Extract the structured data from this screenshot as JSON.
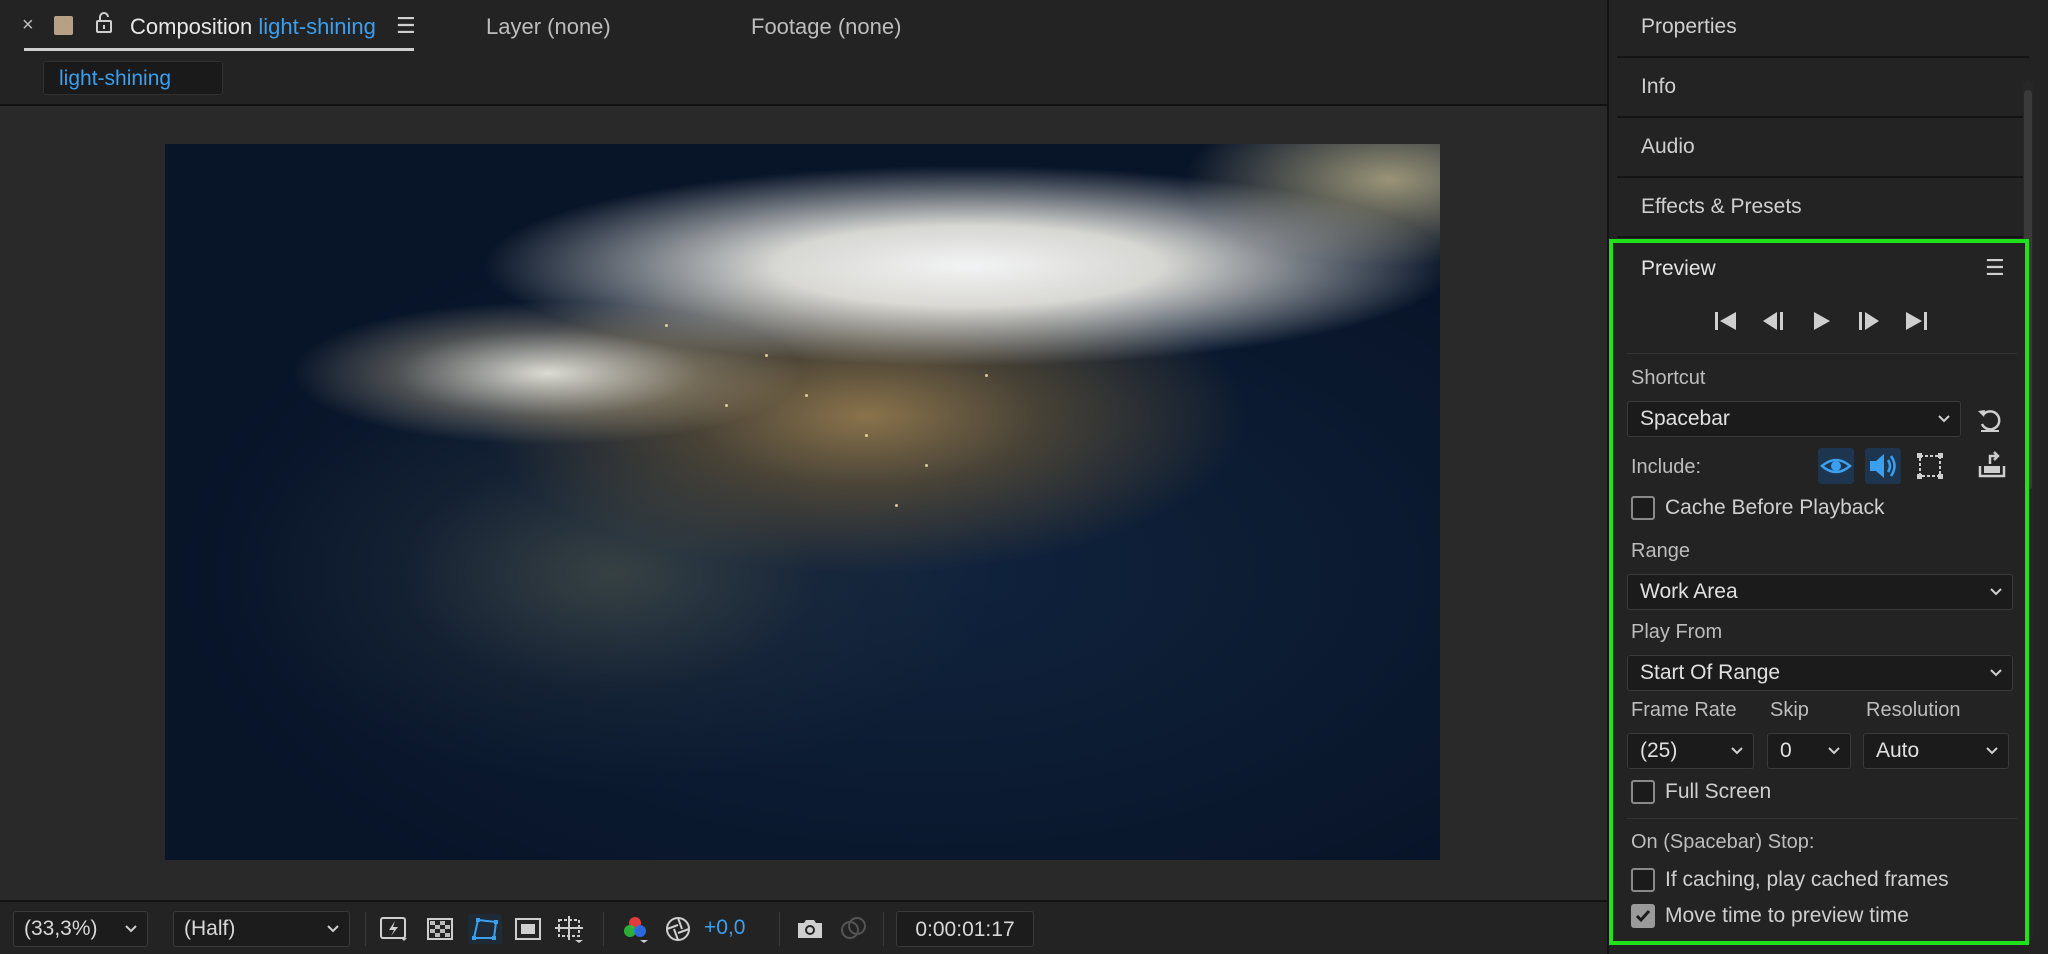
{
  "composition_tab": {
    "close_glyph": "×",
    "title_prefix": "Composition",
    "comp_name": "light-shining",
    "layer_tab": "Layer (none)",
    "footage_tab": "Footage (none)",
    "chip_label": "light-shining",
    "menu_icon": "hamburger-icon",
    "swatch_color": "#b6a186"
  },
  "viewer_toolbar": {
    "magnification": "(33,3%)",
    "resolution": "(Half)",
    "exposure": "+0,0",
    "timecode": "0:00:01:17",
    "icons": [
      "fast-previews-icon",
      "transparency-grid-icon",
      "mask-path-icon",
      "region-of-interest-icon",
      "guides-icon",
      "rgb-channels-icon",
      "reset-exposure-icon",
      "snapshot-icon",
      "show-snapshot-icon"
    ]
  },
  "right_panel": {
    "sections": [
      "Properties",
      "Info",
      "Audio",
      "Effects & Presets"
    ]
  },
  "preview": {
    "title": "Preview",
    "transport_icons": [
      "first-frame-icon",
      "previous-frame-icon",
      "play-icon",
      "next-frame-icon",
      "last-frame-icon"
    ],
    "shortcut_label": "Shortcut",
    "shortcut_value": "Spacebar",
    "include_label": "Include:",
    "include_icons": [
      "video-eye-icon",
      "audio-speaker-icon",
      "overlays-icon",
      "export-icon"
    ],
    "cache_before_playback": {
      "label": "Cache Before Playback",
      "checked": false
    },
    "range_label": "Range",
    "range_value": "Work Area",
    "play_from_label": "Play From",
    "play_from_value": "Start Of Range",
    "frame_rate_label": "Frame Rate",
    "frame_rate_value": "(25)",
    "skip_label": "Skip",
    "skip_value": "0",
    "resolution_label": "Resolution",
    "resolution_value": "Auto",
    "full_screen": {
      "label": "Full Screen",
      "checked": false
    },
    "on_stop_label": "On (Spacebar) Stop:",
    "if_caching": {
      "label": "If caching, play cached frames",
      "checked": false
    },
    "move_time": {
      "label": "Move time to preview time",
      "checked": true
    },
    "highlight_color": "#21e01c",
    "accent_color": "#3b9ff0"
  }
}
